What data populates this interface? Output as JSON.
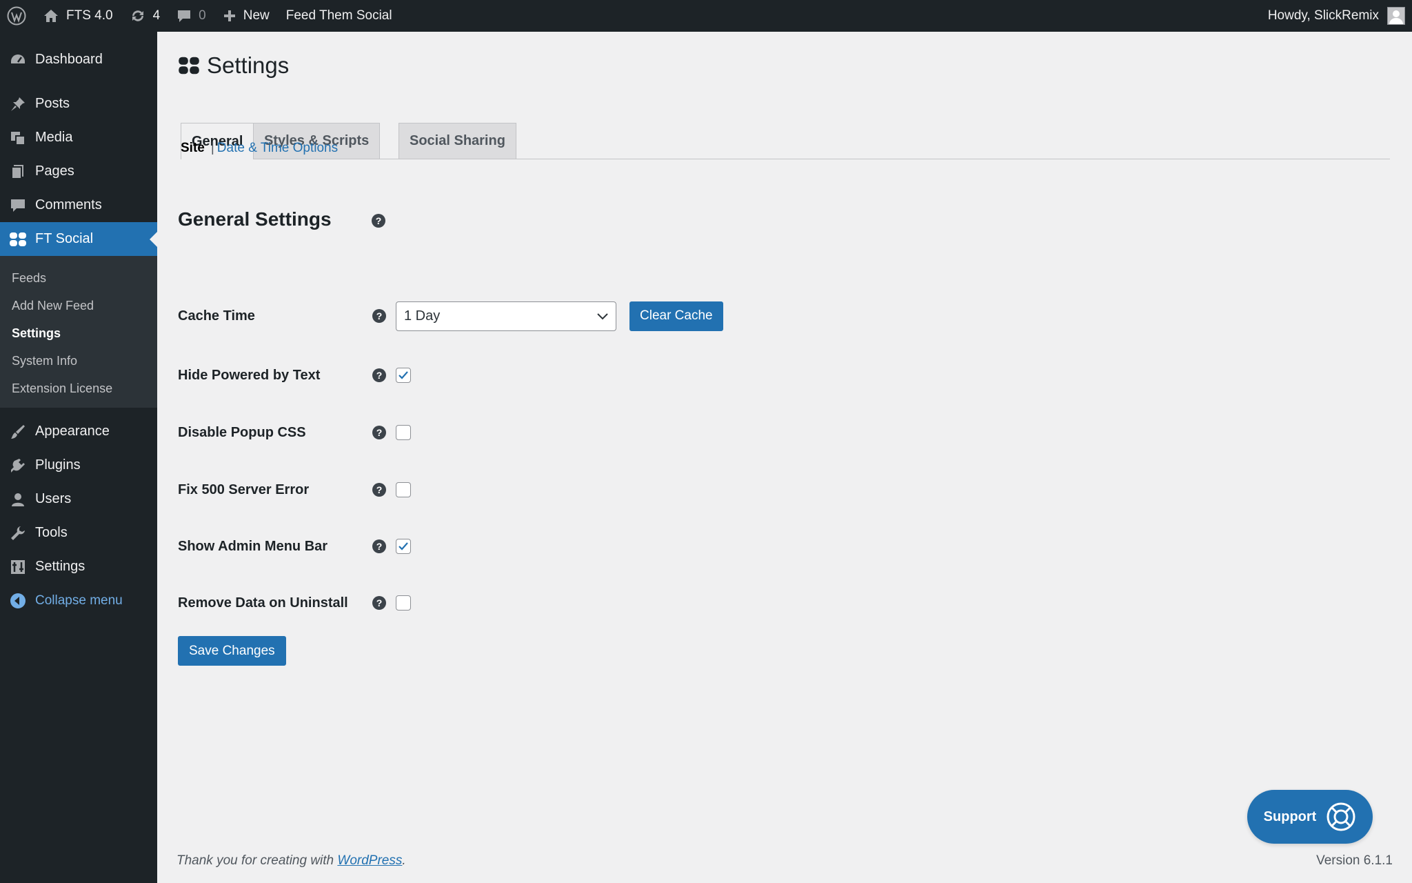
{
  "adminbar": {
    "site_name": "FTS 4.0",
    "updates_count": "4",
    "comments_count": "0",
    "new_label": "New",
    "plugin_link": "Feed Them Social",
    "howdy": "Howdy, SlickRemix"
  },
  "sidebar": {
    "items": [
      {
        "label": "Dashboard",
        "icon": "dashboard-icon"
      },
      {
        "label": "Posts",
        "icon": "pin-icon"
      },
      {
        "label": "Media",
        "icon": "media-icon"
      },
      {
        "label": "Pages",
        "icon": "pages-icon"
      },
      {
        "label": "Comments",
        "icon": "comment-icon"
      },
      {
        "label": "FT Social",
        "icon": "ft-social-icon"
      }
    ],
    "submenu": [
      "Feeds",
      "Add New Feed",
      "Settings",
      "System Info",
      "Extension License"
    ],
    "items_bottom": [
      {
        "label": "Appearance",
        "icon": "brush-icon"
      },
      {
        "label": "Plugins",
        "icon": "plugin-icon"
      },
      {
        "label": "Users",
        "icon": "user-icon"
      },
      {
        "label": "Tools",
        "icon": "wrench-icon"
      },
      {
        "label": "Settings",
        "icon": "settings-icon"
      }
    ],
    "collapse": "Collapse menu"
  },
  "page": {
    "title": "Settings",
    "tabs": [
      "General",
      "Styles & Scripts",
      "Social Sharing"
    ],
    "subnav": {
      "current": "Site",
      "separator": "|",
      "link": "Date & Time Options"
    },
    "section_title": "General Settings",
    "help_glyph": "?",
    "cache_time": {
      "label": "Cache Time",
      "value": "1 Day",
      "button": "Clear Cache"
    },
    "options": [
      {
        "label": "Hide Powered by Text",
        "checked": true
      },
      {
        "label": "Disable Popup CSS",
        "checked": false
      },
      {
        "label": "Fix 500 Server Error",
        "checked": false
      },
      {
        "label": "Show Admin Menu Bar",
        "checked": true
      },
      {
        "label": "Remove Data on Uninstall",
        "checked": false
      }
    ],
    "save_label": "Save Changes",
    "support_label": "Support"
  },
  "footer": {
    "thanks_prefix": "Thank you for creating with ",
    "thanks_link": "WordPress",
    "thanks_suffix": ".",
    "version": "Version 6.1.1"
  },
  "colors": {
    "accent": "#2271b1",
    "sidebar_bg": "#1d2327",
    "content_bg": "#f0f0f1"
  }
}
